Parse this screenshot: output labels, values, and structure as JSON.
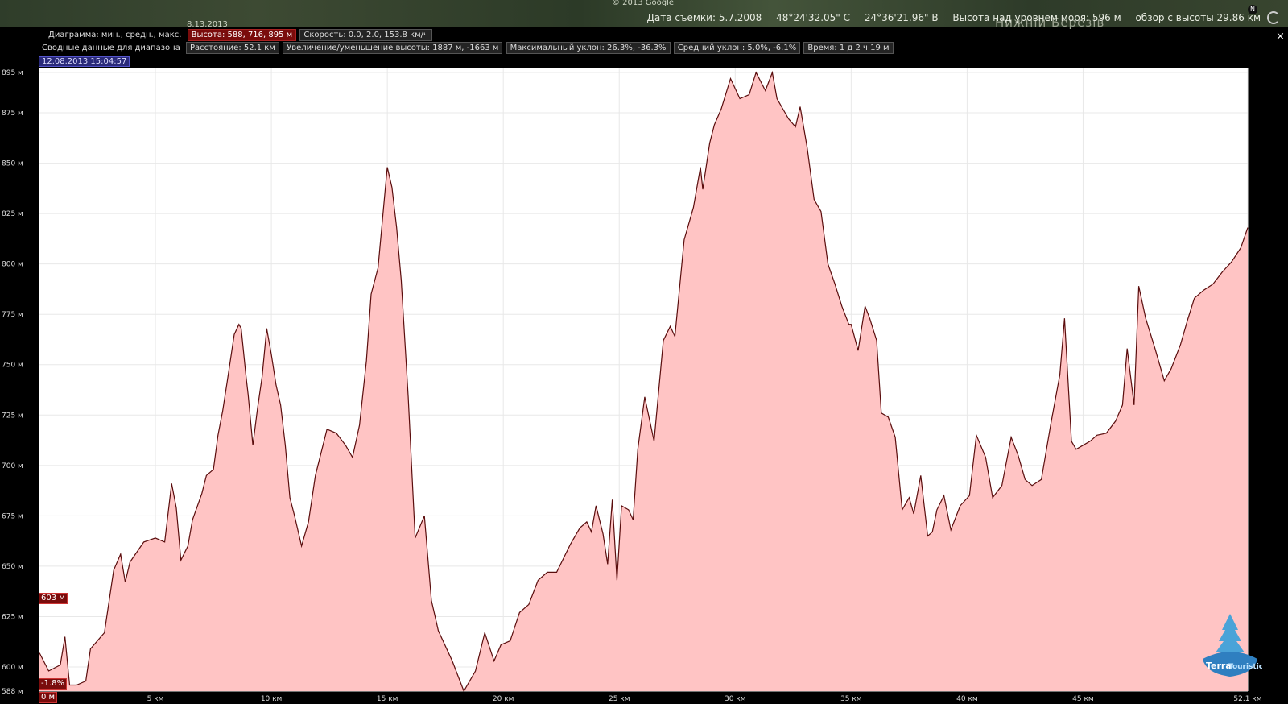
{
  "topbar": {
    "copyright": "© 2013 Google",
    "date_small": "8.13.2013",
    "place_name": "Нижній Березів",
    "imagery_date": "Дата съемки: 5.7.2008",
    "lat": "48°24'32.05\" С",
    "lon": "24°36'21.96\" В",
    "elevation": "Высота над уровнем моря: 596 м",
    "eye_alt": "обзор с высоты 29.86 км",
    "north_label": "N"
  },
  "panel": {
    "row1_label": "Диаграмма: мин., средн., макс.",
    "height_pill": "Высота: 588, 716, 895 м",
    "speed_pill": "Скорость: 0.0, 2.0, 153.8 км/ч",
    "row2_label": "Сводные данные для диапазона",
    "distance": "Расстояние: 52.1 км",
    "gain_loss": "Увеличение/уменьшение высоты: 1887 м, -1663 м",
    "max_slope": "Максимальный уклон: 26.3%, -36.3%",
    "avg_slope": "Средний уклон: 5.0%, -6.1%",
    "time": "Время: 1 д 2 ч 19 м",
    "timestamp": "12.08.2013 15:04:57",
    "close_label": "×"
  },
  "markers": {
    "start_elev": "603 м",
    "slope": "-1.8%",
    "start_dist": "0 м"
  },
  "logo": {
    "line1": "Terra",
    "line2": "Touristica"
  },
  "colors": {
    "fill": "#ffc4c4",
    "line": "#5a0d0d",
    "grid": "#e8e8e8"
  },
  "chart_data": {
    "type": "area",
    "title": "",
    "xlabel": "",
    "ylabel": "",
    "xlim": [
      0,
      52.1
    ],
    "ylim": [
      588,
      895
    ],
    "y_ticks": [
      {
        "v": 895,
        "label": "895 м"
      },
      {
        "v": 875,
        "label": "875 м"
      },
      {
        "v": 850,
        "label": "850 м"
      },
      {
        "v": 825,
        "label": "825 м"
      },
      {
        "v": 800,
        "label": "800 м"
      },
      {
        "v": 775,
        "label": "775 м"
      },
      {
        "v": 750,
        "label": "750 м"
      },
      {
        "v": 725,
        "label": "725 м"
      },
      {
        "v": 700,
        "label": "700 м"
      },
      {
        "v": 675,
        "label": "675 м"
      },
      {
        "v": 650,
        "label": "650 м"
      },
      {
        "v": 625,
        "label": "625 м"
      },
      {
        "v": 600,
        "label": "600 м"
      },
      {
        "v": 588,
        "label": "588 м"
      }
    ],
    "x_ticks": [
      {
        "v": 5,
        "label": "5 км"
      },
      {
        "v": 10,
        "label": "10 км"
      },
      {
        "v": 15,
        "label": "15 км"
      },
      {
        "v": 20,
        "label": "20 км"
      },
      {
        "v": 25,
        "label": "25 км"
      },
      {
        "v": 30,
        "label": "30 км"
      },
      {
        "v": 35,
        "label": "35 км"
      },
      {
        "v": 40,
        "label": "40 км"
      },
      {
        "v": 45,
        "label": "45 км"
      },
      {
        "v": 52.1,
        "label": "52.1 км"
      }
    ],
    "x": [
      0,
      0.4,
      0.9,
      1.1,
      1.3,
      1.6,
      2.0,
      2.2,
      2.8,
      3.2,
      3.5,
      3.7,
      3.9,
      4.5,
      5.0,
      5.4,
      5.7,
      5.9,
      6.1,
      6.4,
      6.6,
      7.0,
      7.2,
      7.5,
      7.7,
      7.9,
      8.1,
      8.4,
      8.6,
      8.7,
      8.9,
      9.0,
      9.2,
      9.4,
      9.6,
      9.8,
      10.0,
      10.2,
      10.4,
      10.6,
      10.8,
      11.0,
      11.3,
      11.6,
      11.9,
      12.4,
      12.8,
      13.2,
      13.5,
      13.8,
      14.1,
      14.3,
      14.6,
      14.9,
      15.0,
      15.2,
      15.4,
      15.6,
      15.9,
      16.2,
      16.6,
      16.9,
      17.2,
      17.8,
      18.3,
      18.8,
      19.2,
      19.6,
      19.9,
      20.3,
      20.7,
      21.1,
      21.5,
      21.9,
      22.3,
      22.9,
      23.3,
      23.6,
      23.8,
      24.0,
      24.3,
      24.5,
      24.7,
      24.9,
      25.1,
      25.4,
      25.6,
      25.8,
      26.1,
      26.5,
      26.9,
      27.2,
      27.4,
      27.8,
      28.2,
      28.5,
      28.6,
      28.9,
      29.1,
      29.4,
      29.8,
      30.2,
      30.6,
      30.9,
      31.3,
      31.6,
      31.8,
      32.1,
      32.3,
      32.6,
      32.8,
      33.1,
      33.4,
      33.7,
      34.0,
      34.3,
      34.6,
      34.9,
      35.0,
      35.3,
      35.6,
      35.8,
      36.1,
      36.3,
      36.6,
      36.9,
      37.2,
      37.5,
      37.7,
      38.0,
      38.3,
      38.5,
      38.7,
      39.0,
      39.3,
      39.7,
      40.1,
      40.4,
      40.8,
      41.1,
      41.5,
      41.9,
      42.2,
      42.5,
      42.8,
      43.2,
      43.6,
      44.0,
      44.2,
      44.5,
      44.7,
      45.0,
      45.3,
      45.6,
      46.0,
      46.4,
      46.7,
      46.9,
      47.2,
      47.4,
      47.7,
      48.1,
      48.5,
      48.8,
      49.2,
      49.5,
      49.8,
      50.2,
      50.6,
      51.0,
      51.4,
      51.8,
      52.1
    ],
    "values": [
      607,
      598,
      601,
      615,
      591,
      591,
      593,
      609,
      617,
      648,
      656,
      642,
      652,
      662,
      664,
      662,
      691,
      679,
      653,
      660,
      673,
      686,
      695,
      698,
      715,
      727,
      742,
      765,
      770,
      768,
      745,
      735,
      710,
      728,
      744,
      768,
      755,
      740,
      730,
      710,
      684,
      675,
      660,
      672,
      695,
      718,
      716,
      710,
      704,
      720,
      752,
      785,
      798,
      836,
      848,
      838,
      818,
      792,
      734,
      664,
      675,
      633,
      618,
      603,
      588,
      598,
      617,
      603,
      611,
      613,
      627,
      631,
      643,
      647,
      647,
      661,
      669,
      672,
      667,
      680,
      666,
      651,
      683,
      643,
      680,
      678,
      673,
      708,
      734,
      712,
      762,
      769,
      764,
      812,
      828,
      848,
      837,
      860,
      869,
      877,
      892,
      882,
      884,
      895,
      886,
      895,
      882,
      876,
      872,
      868,
      878,
      858,
      832,
      826,
      800,
      790,
      779,
      770,
      770,
      757,
      779,
      773,
      762,
      726,
      724,
      714,
      678,
      684,
      676,
      695,
      665,
      667,
      678,
      685,
      668,
      680,
      685,
      715,
      704,
      684,
      690,
      714,
      705,
      693,
      690,
      693,
      720,
      745,
      773,
      712,
      708,
      710,
      712,
      715,
      716,
      722,
      730,
      758,
      730,
      789,
      773,
      758,
      742,
      748,
      760,
      772,
      783,
      787,
      790,
      796,
      801,
      808,
      818,
      831
    ]
  }
}
